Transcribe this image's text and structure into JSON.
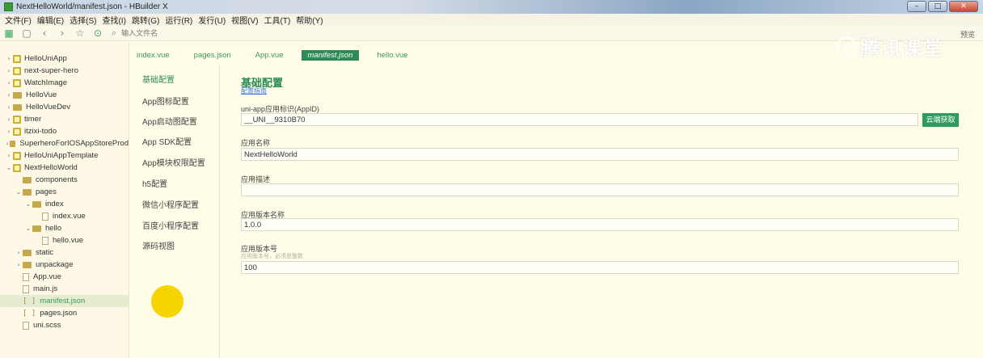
{
  "window": {
    "title": "NextHelloWorld/manifest.json - HBuilder X",
    "controls": [
      "–",
      "□",
      "✕"
    ]
  },
  "menu": [
    "文件(F)",
    "编辑(E)",
    "选择(S)",
    "查找(I)",
    "跳转(G)",
    "运行(R)",
    "发行(U)",
    "视图(V)",
    "工具(T)",
    "帮助(Y)"
  ],
  "toolbar": {
    "search_placeholder": "输入文件名",
    "preview_label": "预览",
    "icons": [
      "grid-icon",
      "save-icon",
      "back-icon",
      "forward-icon",
      "star-icon",
      "run-icon"
    ]
  },
  "watermark": {
    "text": "腾讯课堂"
  },
  "tree": [
    {
      "label": "HelloUniApp",
      "icon": "project-icon",
      "chevron": "›",
      "depth": 0
    },
    {
      "label": "next-super-hero",
      "icon": "project-icon",
      "chevron": "›",
      "depth": 0
    },
    {
      "label": "WatchImage",
      "icon": "project-icon",
      "chevron": "›",
      "depth": 0
    },
    {
      "label": "HelloVue",
      "icon": "folder-icon",
      "chevron": "›",
      "depth": 0
    },
    {
      "label": "HelloVueDev",
      "icon": "folder-icon",
      "chevron": "›",
      "depth": 0
    },
    {
      "label": "timer",
      "icon": "project-icon",
      "chevron": "›",
      "depth": 0
    },
    {
      "label": "itzixi-todo",
      "icon": "project-icon",
      "chevron": "›",
      "depth": 0
    },
    {
      "label": "SuperheroForIOSAppStoreProd",
      "icon": "folder-icon",
      "chevron": "›",
      "depth": 0
    },
    {
      "label": "HelloUniAppTemplate",
      "icon": "project-icon",
      "chevron": "›",
      "depth": 0
    },
    {
      "label": "NextHelloWorld",
      "icon": "project-icon",
      "chevron": "⌄",
      "depth": 0
    },
    {
      "label": "components",
      "icon": "folder-icon",
      "chevron": "",
      "depth": 1
    },
    {
      "label": "pages",
      "icon": "folder-icon",
      "chevron": "⌄",
      "depth": 1
    },
    {
      "label": "index",
      "icon": "folder-icon",
      "chevron": "⌄",
      "depth": 2
    },
    {
      "label": "index.vue",
      "icon": "file-icon",
      "chevron": "",
      "depth": 3
    },
    {
      "label": "hello",
      "icon": "folder-icon",
      "chevron": "⌄",
      "depth": 2
    },
    {
      "label": "hello.vue",
      "icon": "file-icon",
      "chevron": "",
      "depth": 3
    },
    {
      "label": "static",
      "icon": "folder-icon",
      "chevron": "›",
      "depth": 1
    },
    {
      "label": "unpackage",
      "icon": "folder-icon",
      "chevron": "›",
      "depth": 1
    },
    {
      "label": "App.vue",
      "icon": "file-icon",
      "chevron": "",
      "depth": 1
    },
    {
      "label": "main.js",
      "icon": "file-icon",
      "chevron": "",
      "depth": 1
    },
    {
      "label": "manifest.json",
      "icon": "bracket-icon",
      "chevron": "",
      "depth": 1,
      "selected": true
    },
    {
      "label": "pages.json",
      "icon": "bracket-icon",
      "chevron": "",
      "depth": 1
    },
    {
      "label": "uni.scss",
      "icon": "file-icon",
      "chevron": "",
      "depth": 1
    }
  ],
  "tabs": [
    {
      "label": "index.vue",
      "active": false
    },
    {
      "label": "pages.json",
      "active": false
    },
    {
      "label": "App.vue",
      "active": false
    },
    {
      "label": "manifest.json",
      "active": true
    },
    {
      "label": "hello.vue",
      "active": false
    }
  ],
  "settings_nav": [
    {
      "label": "基础配置",
      "active": true
    },
    {
      "label": "App图标配置",
      "active": false
    },
    {
      "label": "App启动图配置",
      "active": false
    },
    {
      "label": "App SDK配置",
      "active": false
    },
    {
      "label": "App模块权限配置",
      "active": false
    },
    {
      "label": "h5配置",
      "active": false
    },
    {
      "label": "微信小程序配置",
      "active": false
    },
    {
      "label": "百度小程序配置",
      "active": false
    },
    {
      "label": "源码视图",
      "active": false
    }
  ],
  "form": {
    "section_title": "基础配置",
    "guide_link": "配置指南",
    "appid": {
      "label": "uni-app应用标识(AppID)",
      "value": "__UNI__9310B70",
      "button": "云端获取"
    },
    "name": {
      "label": "应用名称",
      "value": "NextHelloWorld"
    },
    "description": {
      "label": "应用描述",
      "value": ""
    },
    "version_name": {
      "label": "应用版本名称",
      "value": "1.0.0"
    },
    "version_code": {
      "label": "应用版本号",
      "hint": "应用版本号，必须是整数",
      "value": "100"
    }
  },
  "colors": {
    "accent": "#2e8b57",
    "background": "#fffde8",
    "highlight_dot": "#f5d400"
  }
}
